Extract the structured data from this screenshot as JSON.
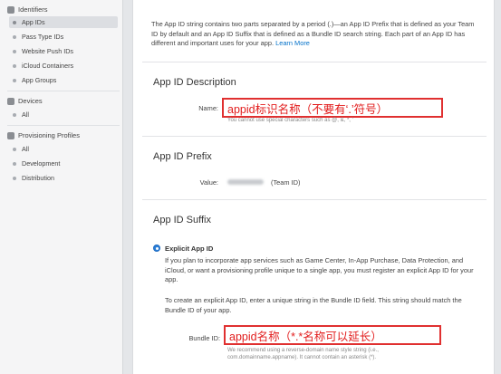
{
  "sidebar": {
    "identifiers": {
      "title": "Identifiers",
      "items": [
        {
          "label": "App IDs"
        },
        {
          "label": "Pass Type IDs"
        },
        {
          "label": "Website Push IDs"
        },
        {
          "label": "iCloud Containers"
        },
        {
          "label": "App Groups"
        }
      ]
    },
    "devices": {
      "title": "Devices",
      "items": [
        {
          "label": "All"
        }
      ]
    },
    "profiles": {
      "title": "Provisioning Profiles",
      "items": [
        {
          "label": "All"
        },
        {
          "label": "Development"
        },
        {
          "label": "Distribution"
        }
      ]
    }
  },
  "main": {
    "intro": "The App ID string contains two parts separated by a period (.)—an App ID Prefix that is defined as your Team ID by default and an App ID Suffix that is defined as a Bundle ID search string. Each part of an App ID has different and important uses for your app.",
    "learn_more": "Learn More",
    "description": {
      "title": "App ID Description",
      "name_label": "Name:",
      "annotation": "appid标识名称（不要有‘.’符号）",
      "hint": "You cannot use special characters such as @, &, *, '"
    },
    "prefix": {
      "title": "App ID Prefix",
      "value_label": "Value:",
      "team_id_suffix": "(Team ID)"
    },
    "suffix": {
      "title": "App ID Suffix",
      "explicit_label": "Explicit App ID",
      "explicit_desc": "If you plan to incorporate app services such as Game Center, In-App Purchase, Data Protection, and iCloud, or want a provisioning profile unique to a single app, you must register an explicit App ID for your app.",
      "explicit_desc2": "To create an explicit App ID, enter a unique string in the Bundle ID field. This string should match the Bundle ID of your app.",
      "bundle_label": "Bundle ID:",
      "bundle_annotation": "appid名称（*.*名称可以延长）",
      "bundle_hint": "We recommend using a reverse-domain name style string (i.e., com.domainname.appname). It cannot contain an asterisk (*)."
    }
  },
  "colors": {
    "accent": "#0070c9",
    "annotation_red": "#e21d1d",
    "radio_blue": "#2a7ed8"
  }
}
